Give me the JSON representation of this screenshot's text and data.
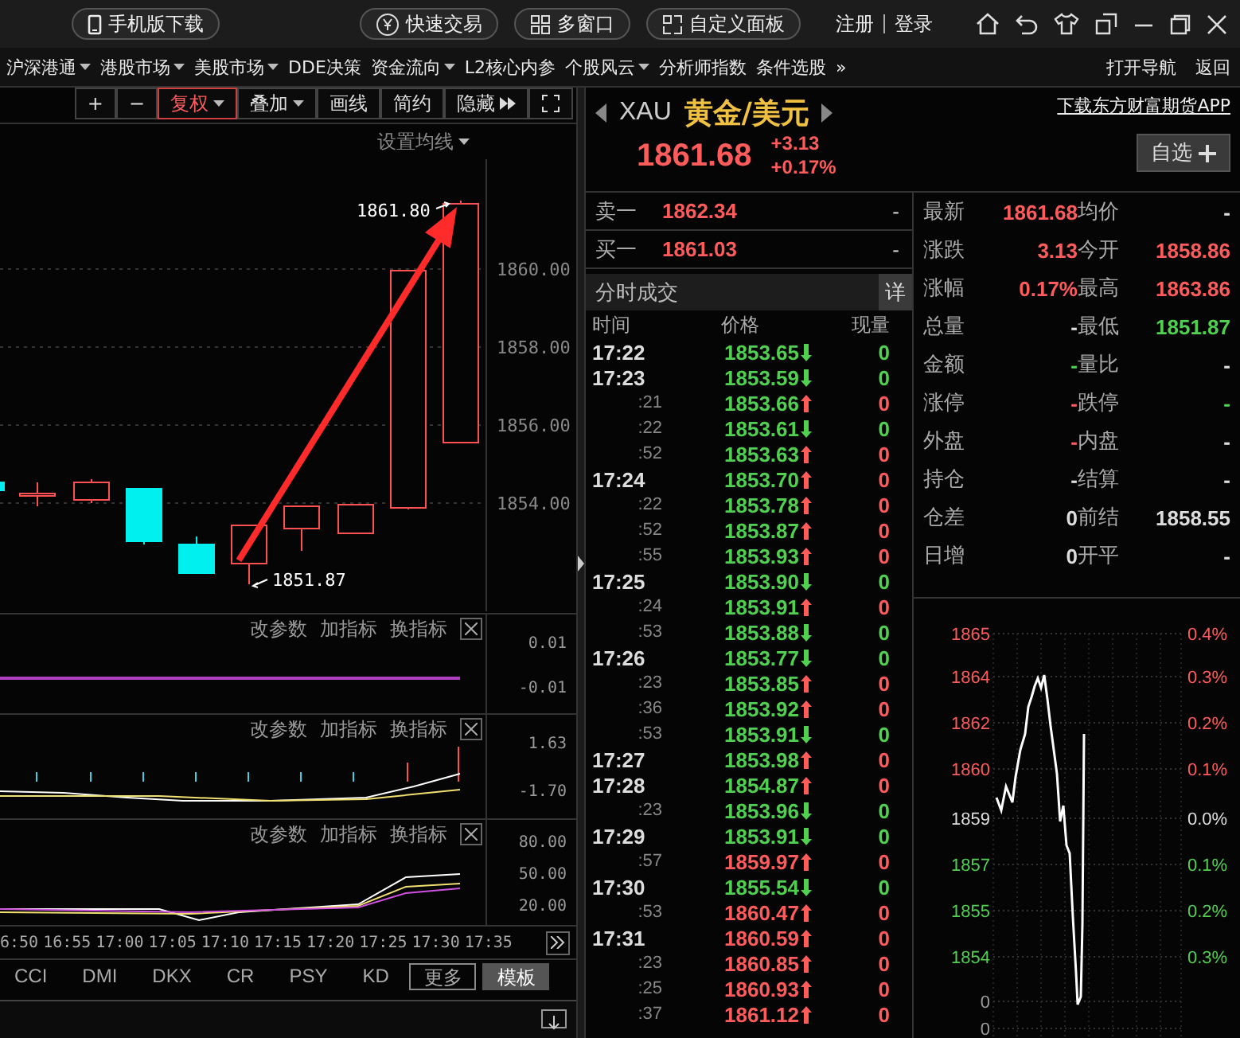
{
  "top_bar": {
    "buttons": [
      {
        "label": "手机版下载",
        "kind": "phone"
      },
      {
        "label": "快速交易",
        "kind": "yen"
      },
      {
        "label": "多窗口",
        "kind": "grid"
      },
      {
        "label": "自定义面板",
        "kind": "panel"
      }
    ],
    "auth_links": [
      "注册",
      "登录"
    ]
  },
  "menu_bar": {
    "items": [
      {
        "label": "沪深港通",
        "dropdown": true
      },
      {
        "label": "港股市场",
        "dropdown": true
      },
      {
        "label": "美股市场",
        "dropdown": true
      },
      {
        "label": "DDE决策",
        "dropdown": false
      },
      {
        "label": "资金流向",
        "dropdown": true
      },
      {
        "label": "L2核心内参",
        "dropdown": false
      },
      {
        "label": "个股风云",
        "dropdown": true
      },
      {
        "label": "分析师指数",
        "dropdown": false
      },
      {
        "label": "条件选股",
        "dropdown": false
      }
    ],
    "more": "»",
    "right_items": [
      "打开导航",
      "返回"
    ]
  },
  "kline_toolbar": [
    {
      "label": "+",
      "dropdown": false,
      "expand_arrows": false,
      "selected": false
    },
    {
      "label": "−",
      "dropdown": false,
      "expand_arrows": false,
      "selected": false
    },
    {
      "label": "复权",
      "dropdown": true,
      "expand_arrows": false,
      "selected": true
    },
    {
      "label": "叠加",
      "dropdown": true,
      "expand_arrows": false,
      "selected": false
    },
    {
      "label": "画线",
      "dropdown": false,
      "expand_arrows": false,
      "selected": false
    },
    {
      "label": "简约",
      "dropdown": false,
      "expand_arrows": false,
      "selected": false
    },
    {
      "label": "隐藏",
      "dropdown": false,
      "expand_arrows": true,
      "selected": false
    }
  ],
  "kline_chart": {
    "ma_setting": "设置均线",
    "y_labels": [
      "1860.00",
      "1858.00",
      "1856.00",
      "1854.00"
    ],
    "high_label": "1861.80",
    "low_label": "1851.87"
  },
  "indicator_panels": [
    {
      "kind": "flat",
      "actions": [
        "改参数",
        "加指标",
        "换指标"
      ],
      "y_labels": [
        "0.01",
        "-0.01"
      ]
    },
    {
      "kind": "bars",
      "actions": [
        "改参数",
        "加指标",
        "换指标"
      ],
      "y_labels": [
        "1.63",
        "-1.70"
      ]
    },
    {
      "kind": "lines",
      "actions": [
        "改参数",
        "加指标",
        "换指标"
      ],
      "y_labels": [
        "80.00",
        "50.00",
        "20.00"
      ]
    }
  ],
  "time_axis": [
    "6:50",
    "16:55",
    "17:00",
    "17:05",
    "17:10",
    "17:15",
    "17:20",
    "17:25",
    "17:30",
    "17:35"
  ],
  "indicator_tabs": [
    {
      "label": "CCI",
      "kind": "tab",
      "selected": false
    },
    {
      "label": "DMI",
      "kind": "tab",
      "selected": false
    },
    {
      "label": "DKX",
      "kind": "tab",
      "selected": false
    },
    {
      "label": "CR",
      "kind": "tab",
      "selected": false
    },
    {
      "label": "PSY",
      "kind": "tab",
      "selected": false
    },
    {
      "label": "KD",
      "kind": "tab",
      "selected": false
    },
    {
      "label": "更多",
      "kind": "boxed",
      "selected": false
    },
    {
      "label": "模板",
      "kind": "tab",
      "selected": true
    }
  ],
  "quote": {
    "symbol": "XAU",
    "name": "黄金/美元",
    "app_link": "下载东方财富期货APP",
    "price": "1861.68",
    "change": "+3.13",
    "change_pct": "+0.17%",
    "watchlist_button": "自选"
  },
  "order_book": [
    {
      "label": "卖一",
      "price": "1862.34",
      "volume": "-"
    },
    {
      "label": "买一",
      "price": "1861.03",
      "volume": "-"
    }
  ],
  "trades": {
    "title": "分时成交",
    "detail_button": "详",
    "columns": [
      "时间",
      "价格",
      "现量"
    ],
    "rows": [
      {
        "time": "17:22",
        "kind": "minute",
        "price": "1853.65",
        "rising": false,
        "above_prev_close": false,
        "volume": "0"
      },
      {
        "time": "17:23",
        "kind": "minute",
        "price": "1853.59",
        "rising": false,
        "above_prev_close": false,
        "volume": "0"
      },
      {
        "time": ":21",
        "kind": "second",
        "price": "1853.66",
        "rising": true,
        "above_prev_close": false,
        "volume": "0"
      },
      {
        "time": ":22",
        "kind": "second",
        "price": "1853.61",
        "rising": false,
        "above_prev_close": false,
        "volume": "0"
      },
      {
        "time": ":52",
        "kind": "second",
        "price": "1853.63",
        "rising": true,
        "above_prev_close": false,
        "volume": "0"
      },
      {
        "time": "17:24",
        "kind": "minute",
        "price": "1853.70",
        "rising": true,
        "above_prev_close": false,
        "volume": "0"
      },
      {
        "time": ":22",
        "kind": "second",
        "price": "1853.78",
        "rising": true,
        "above_prev_close": false,
        "volume": "0"
      },
      {
        "time": ":52",
        "kind": "second",
        "price": "1853.87",
        "rising": true,
        "above_prev_close": false,
        "volume": "0"
      },
      {
        "time": ":55",
        "kind": "second",
        "price": "1853.93",
        "rising": true,
        "above_prev_close": false,
        "volume": "0"
      },
      {
        "time": "17:25",
        "kind": "minute",
        "price": "1853.90",
        "rising": false,
        "above_prev_close": false,
        "volume": "0"
      },
      {
        "time": ":24",
        "kind": "second",
        "price": "1853.91",
        "rising": true,
        "above_prev_close": false,
        "volume": "0"
      },
      {
        "time": ":53",
        "kind": "second",
        "price": "1853.88",
        "rising": false,
        "above_prev_close": false,
        "volume": "0"
      },
      {
        "time": "17:26",
        "kind": "minute",
        "price": "1853.77",
        "rising": false,
        "above_prev_close": false,
        "volume": "0"
      },
      {
        "time": ":23",
        "kind": "second",
        "price": "1853.85",
        "rising": true,
        "above_prev_close": false,
        "volume": "0"
      },
      {
        "time": ":36",
        "kind": "second",
        "price": "1853.92",
        "rising": true,
        "above_prev_close": false,
        "volume": "0"
      },
      {
        "time": ":53",
        "kind": "second",
        "price": "1853.91",
        "rising": false,
        "above_prev_close": false,
        "volume": "0"
      },
      {
        "time": "17:27",
        "kind": "minute",
        "price": "1853.98",
        "rising": true,
        "above_prev_close": false,
        "volume": "0"
      },
      {
        "time": "17:28",
        "kind": "minute",
        "price": "1854.87",
        "rising": true,
        "above_prev_close": false,
        "volume": "0"
      },
      {
        "time": ":23",
        "kind": "second",
        "price": "1853.96",
        "rising": false,
        "above_prev_close": false,
        "volume": "0"
      },
      {
        "time": "17:29",
        "kind": "minute",
        "price": "1853.91",
        "rising": false,
        "above_prev_close": false,
        "volume": "0"
      },
      {
        "time": ":57",
        "kind": "second",
        "price": "1859.97",
        "rising": true,
        "above_prev_close": true,
        "volume": "0"
      },
      {
        "time": "17:30",
        "kind": "minute",
        "price": "1855.54",
        "rising": false,
        "above_prev_close": false,
        "volume": "0"
      },
      {
        "time": ":53",
        "kind": "second",
        "price": "1860.47",
        "rising": true,
        "above_prev_close": true,
        "volume": "0"
      },
      {
        "time": "17:31",
        "kind": "minute",
        "price": "1860.59",
        "rising": true,
        "above_prev_close": true,
        "volume": "0"
      },
      {
        "time": ":23",
        "kind": "second",
        "price": "1860.85",
        "rising": true,
        "above_prev_close": true,
        "volume": "0"
      },
      {
        "time": ":25",
        "kind": "second",
        "price": "1860.93",
        "rising": true,
        "above_prev_close": true,
        "volume": "0"
      },
      {
        "time": ":37",
        "kind": "second",
        "price": "1861.12",
        "rising": true,
        "above_prev_close": true,
        "volume": "0"
      }
    ]
  },
  "stats": [
    {
      "cells": [
        {
          "label": "最新",
          "value": "1861.68",
          "color": "#ff5b5b"
        },
        {
          "label": "均价",
          "value": "-",
          "color": "#dddddd"
        }
      ]
    },
    {
      "cells": [
        {
          "label": "涨跌",
          "value": "3.13",
          "color": "#ff5b5b"
        },
        {
          "label": "今开",
          "value": "1858.86",
          "color": "#ff5b5b"
        }
      ]
    },
    {
      "cells": [
        {
          "label": "涨幅",
          "value": "0.17%",
          "color": "#ff5b5b"
        },
        {
          "label": "最高",
          "value": "1863.86",
          "color": "#ff5b5b"
        }
      ]
    },
    {
      "cells": [
        {
          "label": "总量",
          "value": "-",
          "color": "#dddddd"
        },
        {
          "label": "最低",
          "value": "1851.87",
          "color": "#4fd14f"
        }
      ]
    },
    {
      "cells": [
        {
          "label": "金额",
          "value": "-",
          "color": "#4fd14f"
        },
        {
          "label": "量比",
          "value": "-",
          "color": "#dddddd"
        }
      ]
    },
    {
      "cells": [
        {
          "label": "涨停",
          "value": "-",
          "color": "#ff5b5b"
        },
        {
          "label": "跌停",
          "value": "-",
          "color": "#4fd14f"
        }
      ]
    },
    {
      "cells": [
        {
          "label": "外盘",
          "value": "-",
          "color": "#ff5b5b"
        },
        {
          "label": "内盘",
          "value": "-",
          "color": "#dddddd"
        }
      ]
    },
    {
      "cells": [
        {
          "label": "持仓",
          "value": "-",
          "color": "#dddddd"
        },
        {
          "label": "结算",
          "value": "-",
          "color": "#dddddd"
        }
      ]
    },
    {
      "cells": [
        {
          "label": "仓差",
          "value": "0",
          "color": "#dddddd"
        },
        {
          "label": "前结",
          "value": "1858.55",
          "color": "#dddddd"
        }
      ]
    },
    {
      "cells": [
        {
          "label": "日增",
          "value": "0",
          "color": "#dddddd"
        },
        {
          "label": "开平",
          "value": "-",
          "color": "#dddddd"
        }
      ]
    }
  ],
  "intraday_chart": {
    "price_labels": [
      {
        "text": "1865",
        "color": "#ff5b5b"
      },
      {
        "text": "1864",
        "color": "#ff5b5b"
      },
      {
        "text": "1862",
        "color": "#ff5b5b"
      },
      {
        "text": "1860",
        "color": "#ff5b5b"
      },
      {
        "text": "1859",
        "color": "#dddddd"
      },
      {
        "text": "1857",
        "color": "#4fd14f"
      },
      {
        "text": "1855",
        "color": "#4fd14f"
      },
      {
        "text": "1854",
        "color": "#4fd14f"
      }
    ],
    "pct_labels": [
      {
        "text": "0.4%",
        "color": "#ff5b5b"
      },
      {
        "text": "0.3%",
        "color": "#ff5b5b"
      },
      {
        "text": "0.2%",
        "color": "#ff5b5b"
      },
      {
        "text": "0.1%",
        "color": "#ff5b5b"
      },
      {
        "text": "0.0%",
        "color": "#dddddd"
      },
      {
        "text": "0.1%",
        "color": "#4fd14f"
      },
      {
        "text": "0.2%",
        "color": "#4fd14f"
      },
      {
        "text": "0.3%",
        "color": "#4fd14f"
      }
    ],
    "volume_labels": [
      "0",
      "0"
    ]
  }
}
